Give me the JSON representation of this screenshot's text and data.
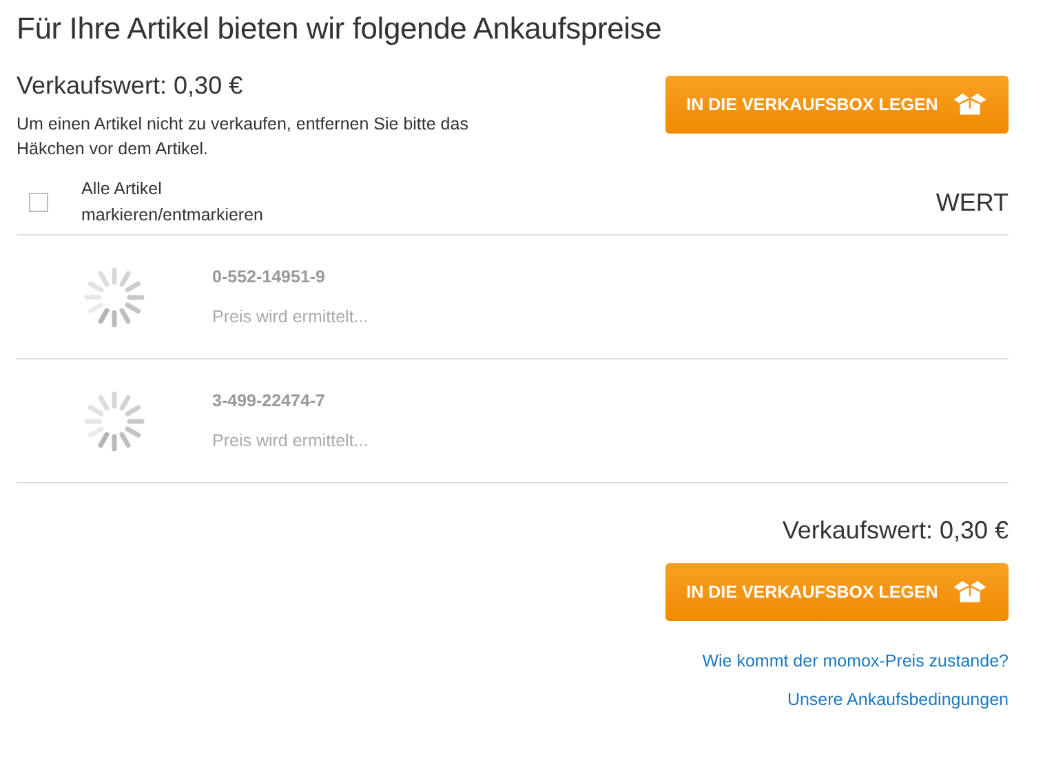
{
  "title": "Für Ihre Artikel bieten wir folgende Ankaufspreise",
  "summary": {
    "value": "Verkaufswert: 0,30 €",
    "note": "Um einen Artikel nicht zu verkaufen, entfernen Sie bitte das Häkchen vor dem Artikel.",
    "button": "IN DIE VERKAUFSBOX LEGEN"
  },
  "select_all": {
    "label": "Alle Artikel markieren/entmarkieren",
    "checked": false
  },
  "column_header": "WERT",
  "items": [
    {
      "isbn": "0-552-14951-9",
      "status": "Preis wird ermittelt...",
      "loading": true
    },
    {
      "isbn": "3-499-22474-7",
      "status": "Preis wird ermittelt...",
      "loading": true
    }
  ],
  "footer": {
    "value": "Verkaufswert: 0,30 €",
    "button": "IN DIE VERKAUFSBOX LEGEN",
    "links": [
      "Wie kommt der momox-Preis zustande?",
      "Unsere Ankaufsbedingungen"
    ]
  }
}
